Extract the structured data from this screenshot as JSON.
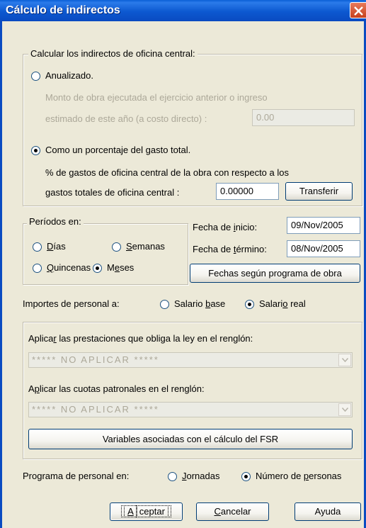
{
  "window": {
    "title": "Cálculo de indirectos"
  },
  "calc_group": {
    "legend": "Calcular los indirectos de oficina central:",
    "annualized_label": "Anualizado.",
    "annualized_selected": false,
    "amount_line1": "Monto de obra ejecutada el ejercicio anterior o ingreso",
    "amount_line2": "estimado de este año (a costo directo) :",
    "amount_value": "0.00",
    "percentage_label": "Como un porcentaje del gasto total.",
    "percentage_selected": true,
    "percent_line1": "% de gastos de oficina central de la obra con respecto a los",
    "percent_line2": "gastos totales de oficina central :",
    "percent_value": "0.00000",
    "transfer_button": "Transferir"
  },
  "periods": {
    "legend": "Períodos en:",
    "options": [
      {
        "label": "Días",
        "selected": false
      },
      {
        "label": "Semanas",
        "selected": false
      },
      {
        "label": "Quincenas",
        "selected": false
      },
      {
        "label": "Meses",
        "selected": true
      }
    ]
  },
  "dates": {
    "start_label": "Fecha de inicio:",
    "start_value": "09/Nov/2005",
    "end_label": "Fecha de término:",
    "end_value": "08/Nov/2005",
    "schedule_button": "Fechas según programa de obra"
  },
  "personnel_amounts": {
    "label": "Importes de personal a:",
    "base_salary": "Salario base",
    "real_salary": "Salario real",
    "selected": "real"
  },
  "benefits_group": {
    "benefits_label": "Aplicar las prestaciones que obliga la ley en el renglón:",
    "benefits_value": "***** NO APLICAR *****",
    "quotas_label": "Aplicar las cuotas patronales en el renglón:",
    "quotas_value": "***** NO APLICAR *****",
    "fsr_button": "Variables asociadas con el cálculo del FSR"
  },
  "personnel_schedule": {
    "label": "Programa de personal en:",
    "shifts": "Jornadas",
    "people": "Número de personas",
    "selected": "people"
  },
  "buttons": {
    "accept": "Aceptar",
    "cancel": "Cancelar",
    "help": "Ayuda"
  }
}
